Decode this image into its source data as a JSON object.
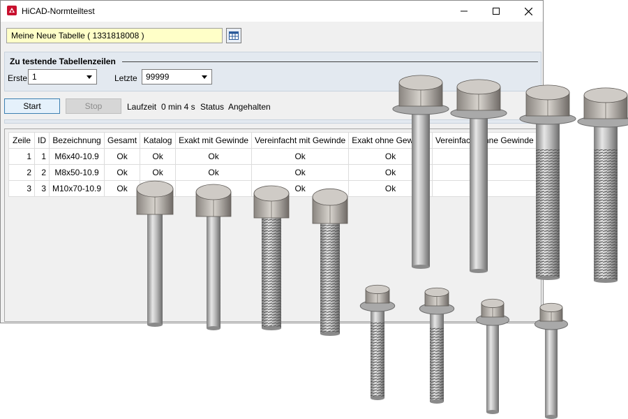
{
  "window": {
    "title": "HiCAD-Normteiltest"
  },
  "table_field": {
    "value": "Meine Neue Tabelle ( 1331818008 )"
  },
  "range": {
    "group_title": "Zu testende Tabellenzeilen",
    "first_label": "Erste",
    "first_value": "1",
    "last_label": "Letzte",
    "last_value": "99999"
  },
  "controls": {
    "start_label": "Start",
    "stop_label": "Stop",
    "runtime_label": "Laufzeit",
    "runtime_value": "0 min 4 s",
    "status_label": "Status",
    "status_value": "Angehalten"
  },
  "grid": {
    "columns": [
      "Zeile",
      "ID",
      "Bezeichnung",
      "Gesamt",
      "Katalog",
      "Exakt mit Gewinde",
      "Vereinfacht mit Gewinde",
      "Exakt ohne Gewinde",
      "Vereinfacht ohne Gewinde"
    ],
    "rows": [
      [
        "1",
        "1",
        "M6x40-10.9",
        "Ok",
        "Ok",
        "Ok",
        "Ok",
        "Ok",
        ""
      ],
      [
        "2",
        "2",
        "M8x50-10.9",
        "Ok",
        "Ok",
        "Ok",
        "Ok",
        "Ok",
        ""
      ],
      [
        "3",
        "3",
        "M10x70-10.9",
        "Ok",
        "",
        "",
        "Ok",
        "Ok",
        ""
      ]
    ]
  },
  "colors": {
    "input_yellow": "#ffffc8",
    "group_bg": "#e3e9f0",
    "button_border": "#3c7fb1"
  }
}
